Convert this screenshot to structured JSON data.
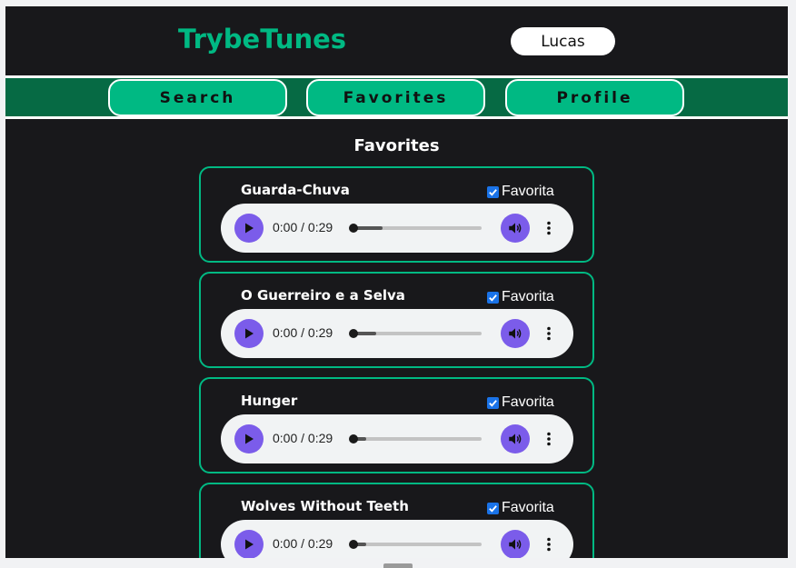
{
  "app": {
    "title": "TrybeTunes",
    "brand_color": "#00b983",
    "nav_bg": "#066a44"
  },
  "header": {
    "username": "Lucas"
  },
  "nav": {
    "items": [
      {
        "label": "Search"
      },
      {
        "label": "Favorites"
      },
      {
        "label": "Profile"
      }
    ]
  },
  "main": {
    "title": "Favorites",
    "checkbox_label": "Favorita",
    "tracks": [
      {
        "name": "Guarda-Chuva",
        "time": "0:00 / 0:29",
        "favorite": true,
        "buffered": 0.24
      },
      {
        "name": "O Guerreiro e a Selva",
        "time": "0:00 / 0:29",
        "favorite": true,
        "buffered": 0.19
      },
      {
        "name": "Hunger",
        "time": "0:00 / 0:29",
        "favorite": true,
        "buffered": 0.11
      },
      {
        "name": "Wolves Without Teeth",
        "time": "0:00 / 0:29",
        "favorite": true,
        "buffered": 0.11
      }
    ]
  },
  "icons": {
    "play": "play-icon",
    "volume": "volume-icon",
    "more": "more-vertical-icon",
    "check": "check-icon"
  },
  "colors": {
    "accent_purple": "#7b5cea",
    "checkbox_blue": "#1a73e8"
  }
}
